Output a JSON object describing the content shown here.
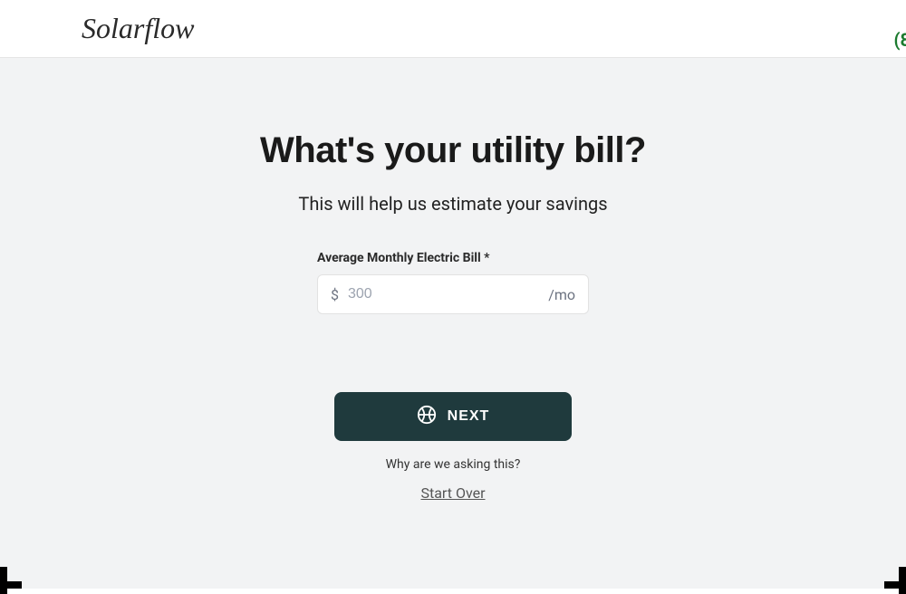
{
  "header": {
    "logo": "Solarflow",
    "phone_fragment": "(8"
  },
  "main": {
    "heading": "What's your utility bill?",
    "subheading": "This will help us estimate your savings",
    "field": {
      "label": "Average Monthly Electric Bill *",
      "prefix": "$",
      "placeholder": "300",
      "value": "",
      "suffix": "/mo"
    },
    "next_label": "NEXT",
    "why_link": "Why are we asking this?",
    "start_over": "Start Over"
  }
}
